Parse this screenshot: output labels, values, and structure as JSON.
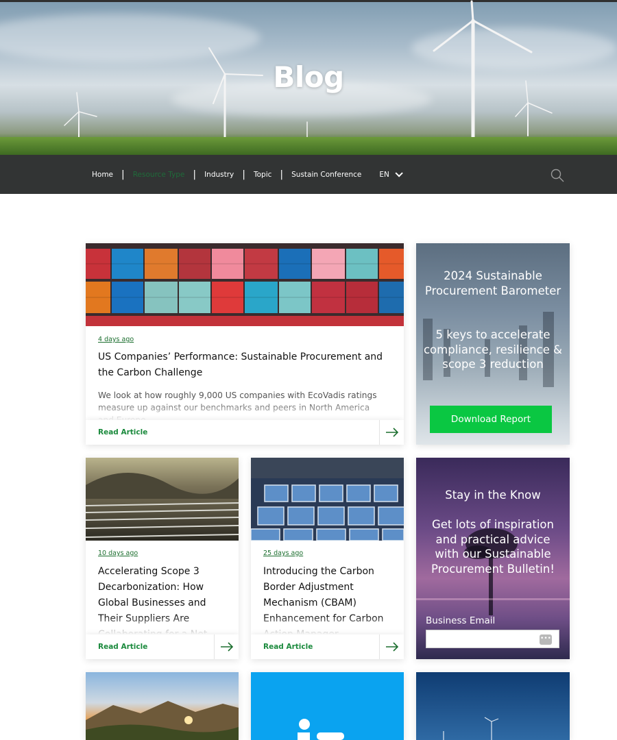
{
  "hero": {
    "title": "Blog"
  },
  "nav": {
    "items": [
      "Home",
      "Resource Type",
      "Industry",
      "Topic",
      "Sustain Conference"
    ],
    "separator": "|",
    "lang": "EN"
  },
  "articles": [
    {
      "date": "4 days ago",
      "title": "US Companies’ Performance: Sustainable Procurement and the Carbon Challenge",
      "excerpt": "We look at how roughly 9,000 US companies with EcoVadis ratings measure up against our benchmarks and peers in North America and Europe.",
      "cta": "Read Article"
    },
    {
      "date": "10 days ago",
      "title": "Accelerating Scope 3 Decarbonization: How Global Businesses and Their Suppliers Are Collaborating for a Net-",
      "cta": "Read Article"
    },
    {
      "date": "25 days ago",
      "title": "Introducing the Carbon Border Adjustment Mechanism (CBAM) Enhancement for Carbon Action Manager",
      "cta": "Read Article"
    }
  ],
  "promo_report": {
    "heading": "2024 Sustainable Procurement Barometer",
    "subheading": "5 keys to accelerate compliance, resilience & scope 3 reduction",
    "button": "Download Report"
  },
  "promo_newsletter": {
    "heading": "Stay in the Know",
    "body": "Get lots of inspiration and practical advice with our Sustainable Procurement Bulletin!",
    "email_label": "Business Email",
    "email_value": ""
  },
  "colors": {
    "accent_green": "#0ac742",
    "link_green": "#1b8a3d",
    "nav_bg": "#323434",
    "active_nav": "#1f6b3a"
  }
}
